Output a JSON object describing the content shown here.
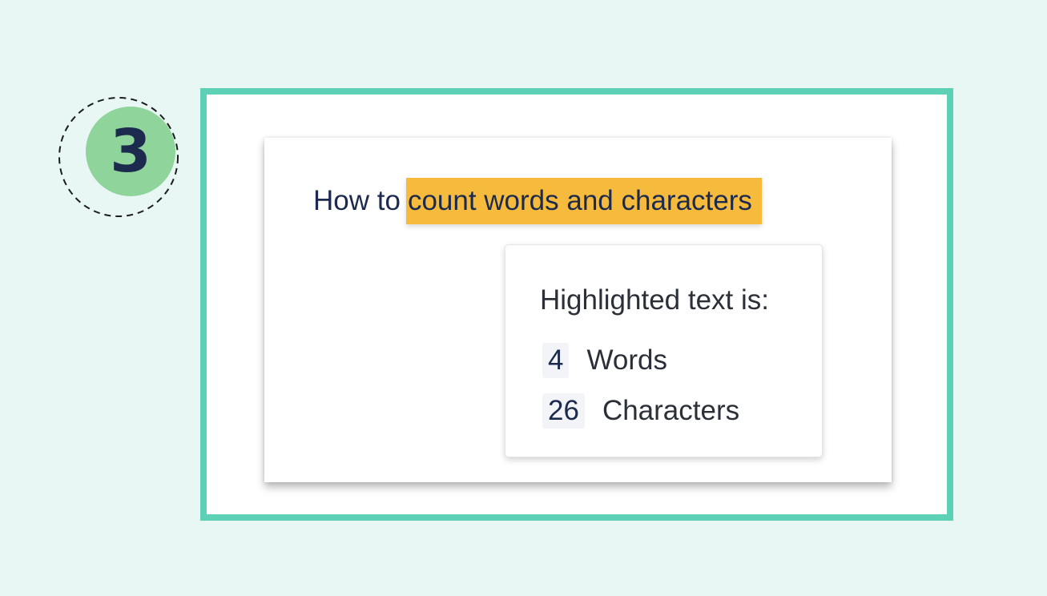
{
  "step": {
    "number": "3",
    "icon": "dashed-circle-step-badge",
    "fill_color": "#8fd49a",
    "number_color": "#1c2a4d"
  },
  "frame": {
    "border_color": "#5dd1b6"
  },
  "document": {
    "heading_plain": "How to",
    "heading_highlighted": "count words and characters",
    "highlight_color": "#f6ba3d"
  },
  "popup": {
    "title": "Highlighted text is:",
    "stats": [
      {
        "value": "4",
        "label": "Words"
      },
      {
        "value": "26",
        "label": "Characters"
      }
    ]
  },
  "colors": {
    "background": "#e8f7f3",
    "accent": "#5dd1b6",
    "text_dark": "#1c2a4d"
  }
}
